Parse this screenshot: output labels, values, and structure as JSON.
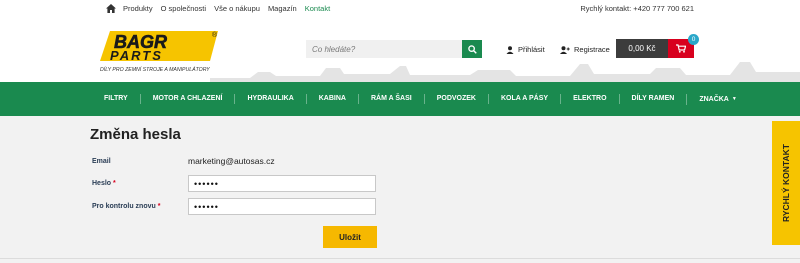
{
  "topbar": {
    "nav": [
      "Produkty",
      "O společnosti",
      "Vše o nákupu",
      "Magazín",
      "Kontakt"
    ],
    "active": "Kontakt",
    "quick_contact": "Rychlý kontakt: +420 777 700 621"
  },
  "logo": {
    "name": "BAGR PARTS",
    "tagline": "DÍLY PRO ZEMNÍ STROJE A MANIPULÁTORY",
    "registered_mark": "®"
  },
  "search": {
    "placeholder": "Co hledáte?",
    "icon": "search-icon"
  },
  "account": {
    "login_label": "Přihlásit",
    "register_label": "Registrace"
  },
  "cart": {
    "price": "0,00 Kč",
    "count": "0",
    "icon": "cart-icon"
  },
  "mainnav": {
    "items": [
      "FILTRY",
      "MOTOR A CHLAZENÍ",
      "HYDRAULIKA",
      "KABINA",
      "RÁM A ŠASI",
      "PODVOZEK",
      "KOLA A PÁSY",
      "ELEKTRO",
      "DÍLY RAMEN",
      "ZNAČKA"
    ]
  },
  "page": {
    "title": "Změna hesla",
    "email_label": "Email",
    "email_value": "marketing@autosas.cz",
    "password_label": "Heslo",
    "confirm_label": "Pro kontrolu znovu",
    "required_mark": "*",
    "password_value": "••••••",
    "confirm_value": "••••••",
    "save_label": "Uložit"
  },
  "sidetab": {
    "label": "RYCHLÝ KONTAKT"
  },
  "colors": {
    "green": "#1a8a4f",
    "yellow": "#f6c400",
    "red": "#d8001e",
    "dark": "#3c3c3c"
  }
}
